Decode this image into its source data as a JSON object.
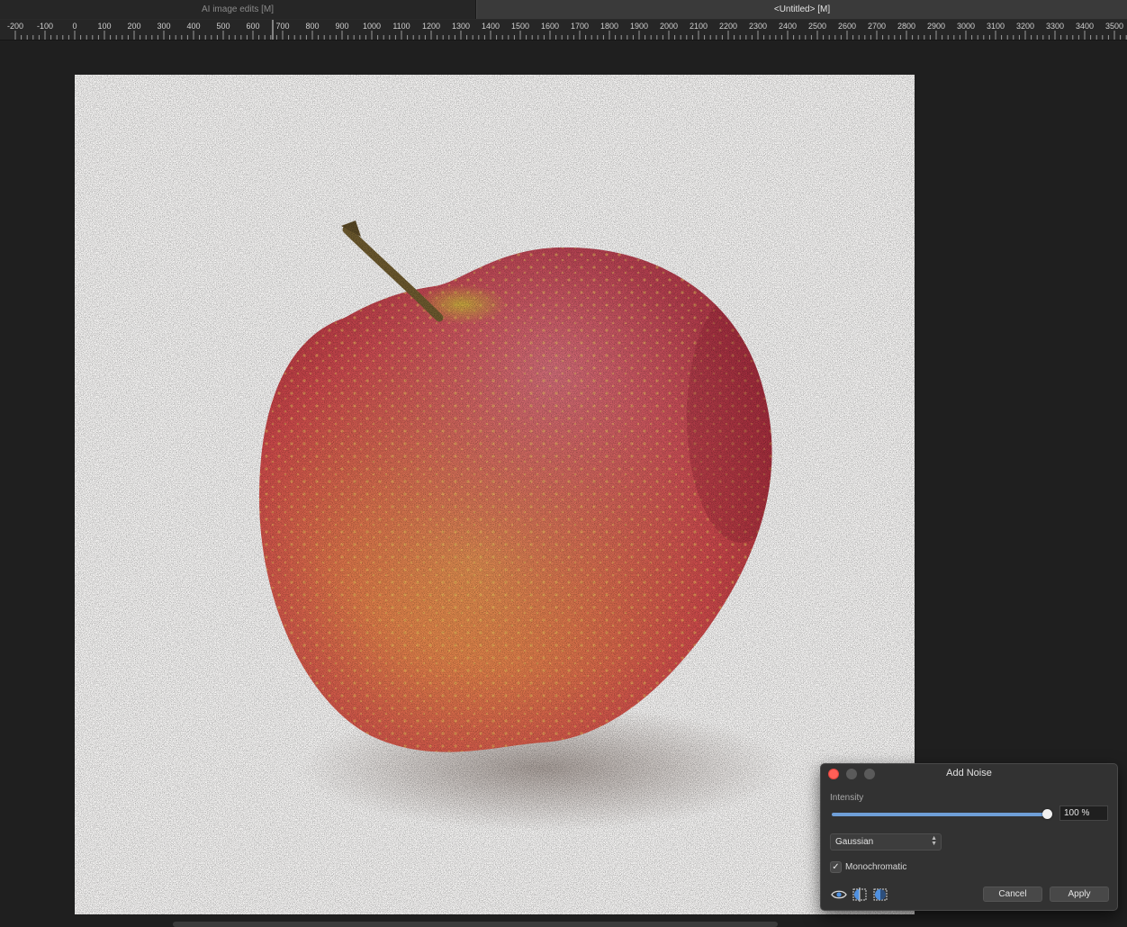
{
  "tabs": [
    {
      "label": "AI image edits [M]",
      "active": false
    },
    {
      "label": "<Untitled> [M]",
      "active": true
    }
  ],
  "ruler": {
    "labels": [
      "-200",
      "-100",
      "0",
      "100",
      "200",
      "300",
      "400",
      "500",
      "600",
      "700",
      "800",
      "900",
      "1000",
      "1100",
      "1200",
      "1300",
      "1400",
      "1500",
      "1600",
      "1700",
      "1800",
      "1900",
      "2000",
      "2100",
      "2200",
      "2300",
      "2400",
      "2500",
      "2600",
      "2700",
      "2800",
      "2900",
      "3000",
      "3100",
      "3200",
      "3300",
      "3400",
      "3500"
    ]
  },
  "canvas": {
    "image_subject": "red apple photo with noise filter applied"
  },
  "dialog": {
    "title": "Add Noise",
    "intensity_label": "Intensity",
    "intensity_value": "100 %",
    "intensity_fraction": 1.0,
    "noise_type": "Gaussian",
    "monochromatic_label": "Monochromatic",
    "monochromatic_checked": true,
    "check_glyph": "✓",
    "preview_icons": [
      "eye-icon",
      "split-compare-icon",
      "mirror-compare-icon"
    ],
    "cancel_label": "Cancel",
    "apply_label": "Apply"
  },
  "colors": {
    "accent": "#6f9fd8",
    "close_button": "#fe5f57"
  }
}
